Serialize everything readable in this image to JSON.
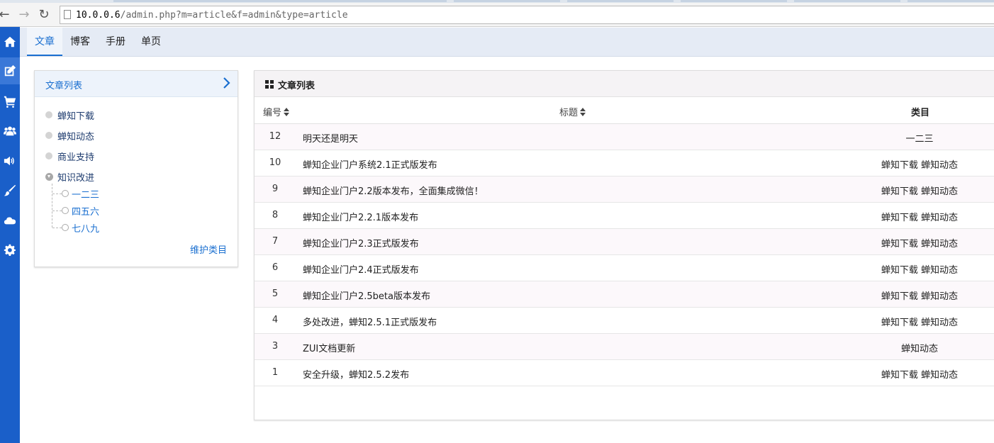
{
  "browser": {
    "url_host": "10.0.0.6",
    "url_path": "/admin.php?m=article&f=admin&type=article"
  },
  "rail": {
    "items": [
      {
        "icon": "home-icon"
      },
      {
        "icon": "edit-icon",
        "active": true
      },
      {
        "icon": "cart-icon"
      },
      {
        "icon": "users-icon"
      },
      {
        "icon": "volume-icon"
      },
      {
        "icon": "brush-icon"
      },
      {
        "icon": "cloud-icon"
      },
      {
        "icon": "gear-icon"
      }
    ],
    "color": "#1a5fc9"
  },
  "topnav": {
    "tabs": [
      {
        "label": "文章",
        "active": true
      },
      {
        "label": "博客"
      },
      {
        "label": "手册"
      },
      {
        "label": "单页"
      }
    ]
  },
  "sidebar": {
    "title": "文章列表",
    "categories": [
      {
        "label": "蝉知下载"
      },
      {
        "label": "蝉知动态"
      },
      {
        "label": "商业支持"
      },
      {
        "label": "知识改进",
        "expanded": true,
        "children": [
          {
            "label": "一二三"
          },
          {
            "label": "四五六"
          },
          {
            "label": "七八九"
          }
        ]
      }
    ],
    "maintain_label": "维护类目"
  },
  "main": {
    "title": "文章列表",
    "columns": {
      "id": "编号",
      "title": "标题",
      "category": "类目"
    },
    "rows": [
      {
        "id": "12",
        "title": "明天还是明天",
        "category": "一二三"
      },
      {
        "id": "10",
        "title": "蝉知企业门户系统2.1正式版发布",
        "category": "蝉知下载 蝉知动态"
      },
      {
        "id": "9",
        "title": "蝉知企业门户2.2版本发布，全面集成微信！",
        "category": "蝉知下载 蝉知动态"
      },
      {
        "id": "8",
        "title": "蝉知企业门户2.2.1版本发布",
        "category": "蝉知下载 蝉知动态"
      },
      {
        "id": "7",
        "title": "蝉知企业门户2.3正式版发布",
        "category": "蝉知下载 蝉知动态"
      },
      {
        "id": "6",
        "title": "蝉知企业门户2.4正式版发布",
        "category": "蝉知下载 蝉知动态"
      },
      {
        "id": "5",
        "title": "蝉知企业门户2.5beta版本发布",
        "category": "蝉知下载 蝉知动态"
      },
      {
        "id": "4",
        "title": "多处改进，蝉知2.5.1正式版发布",
        "category": "蝉知下载 蝉知动态"
      },
      {
        "id": "3",
        "title": "ZUI文档更新",
        "category": "蝉知动态"
      },
      {
        "id": "1",
        "title": "安全升级，蝉知2.5.2发布",
        "category": "蝉知下载 蝉知动态"
      }
    ]
  },
  "colors": {
    "accent": "#1a6fd0",
    "rail": "#1a5fc9"
  }
}
